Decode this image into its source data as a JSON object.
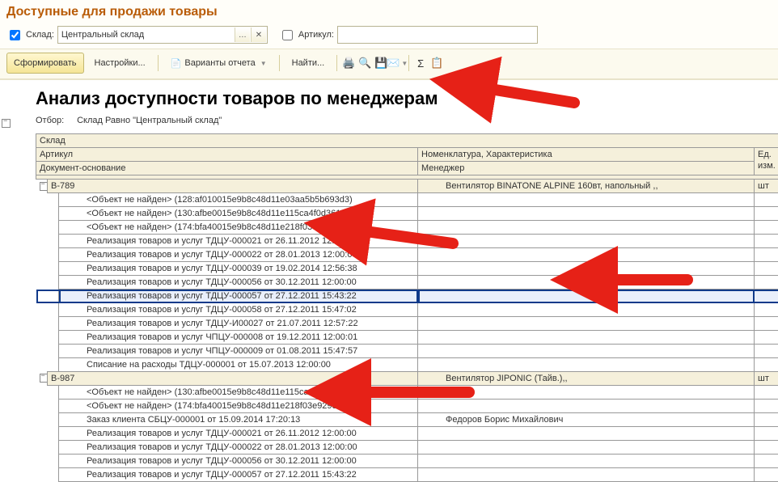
{
  "page_title": "Доступные для продажи товары",
  "filter": {
    "sklad_checked": true,
    "sklad_label": "Склад:",
    "sklad_value": "Центральный склад",
    "art_checked": false,
    "art_label": "Артикул:",
    "art_value": ""
  },
  "toolbar": {
    "form": "Сформировать",
    "settings": "Настройки...",
    "variants": "Варианты отчета",
    "find": "Найти..."
  },
  "report": {
    "title": "Анализ доступности товаров по менеджерам",
    "filter_label": "Отбор:",
    "filter_value": "Склад Равно \"Центральный склад\"",
    "cols": {
      "sklad": "Склад",
      "article": "Артикул",
      "nomen": "Номенклатура, Характеристика",
      "ed": "Ед. изм.",
      "doc": "Документ-основание",
      "manager": "Менеджер"
    },
    "groups": [
      {
        "article": "В-789",
        "nomen": "Вентилятор BINATONE ALPINE 160вт, напольный ,,",
        "ed": "шт",
        "rows": [
          {
            "doc": "<Объект не найден> (128:af010015e9b8c48d11e03aa5b5b693d3)",
            "mgr": ""
          },
          {
            "doc": "<Объект не найден> (130:afbe0015e9b8c48d11e115ca4f0d3618)",
            "mgr": ""
          },
          {
            "doc": "<Объект не найден> (174:bfa40015e9b8c48d11e218f03e929e6e)",
            "mgr": ""
          },
          {
            "doc": "Реализация товаров и услуг ТДЦУ-000021 от 26.11.2012 12:00:00",
            "mgr": ""
          },
          {
            "doc": "Реализация товаров и услуг ТДЦУ-000022 от 28.01.2013 12:00:00",
            "mgr": ""
          },
          {
            "doc": "Реализация товаров и услуг ТДЦУ-000039 от 19.02.2014 12:56:38",
            "mgr": ""
          },
          {
            "doc": "Реализация товаров и услуг ТДЦУ-000056 от 30.12.2011 12:00:00",
            "mgr": ""
          },
          {
            "doc": "Реализация товаров и услуг ТДЦУ-000057 от 27.12.2011 15:43:22",
            "mgr": "",
            "sel": true
          },
          {
            "doc": "Реализация товаров и услуг ТДЦУ-000058 от 27.12.2011 15:47:02",
            "mgr": ""
          },
          {
            "doc": "Реализация товаров и услуг ТДЦУ-И00027 от 21.07.2011 12:57:22",
            "mgr": ""
          },
          {
            "doc": "Реализация товаров и услуг ЧПЦУ-000008 от 19.12.2011 12:00:01",
            "mgr": ""
          },
          {
            "doc": "Реализация товаров и услуг ЧПЦУ-000009 от 01.08.2011 15:47:57",
            "mgr": ""
          },
          {
            "doc": "Списание на расходы ТДЦУ-000001 от 15.07.2013 12:00:00",
            "mgr": ""
          }
        ]
      },
      {
        "article": "В-987",
        "nomen": "Вентилятор JIPONIC (Тайв.),,",
        "ed": "шт",
        "rows": [
          {
            "doc": "<Объект не найден> (130:afbe0015e9b8c48d11e115ca4f0d3618)",
            "mgr": ""
          },
          {
            "doc": "<Объект не найден> (174:bfa40015e9b8c48d11e218f03e929e6e)",
            "mgr": ""
          },
          {
            "doc": "Заказ клиента СБЦУ-000001 от 15.09.2014 17:20:13",
            "mgr": "Федоров Борис Михайлович"
          },
          {
            "doc": "Реализация товаров и услуг ТДЦУ-000021 от 26.11.2012 12:00:00",
            "mgr": ""
          },
          {
            "doc": "Реализация товаров и услуг ТДЦУ-000022 от 28.01.2013 12:00:00",
            "mgr": ""
          },
          {
            "doc": "Реализация товаров и услуг ТДЦУ-000056 от 30.12.2011 12:00:00",
            "mgr": ""
          },
          {
            "doc": "Реализация товаров и услуг ТДЦУ-000057 от 27.12.2011 15:43:22",
            "mgr": ""
          }
        ]
      }
    ]
  }
}
